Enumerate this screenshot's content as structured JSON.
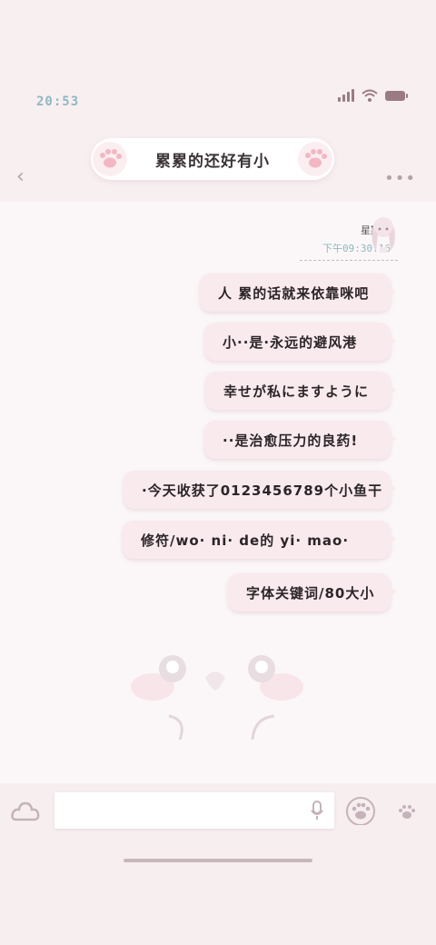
{
  "status_bar": {
    "time": "20:53",
    "icons": [
      "signal-icon",
      "wifi-icon",
      "battery-icon"
    ]
  },
  "header": {
    "title": "累累的还好有小",
    "back_icon": "chevron-left-icon",
    "more_icon": "more-icon",
    "more_label": "•••"
  },
  "thread": {
    "day_label": "星期五",
    "time_label": "下午09:30:16"
  },
  "messages": [
    {
      "text": "人 累的话就来依靠咪吧"
    },
    {
      "text": "小··是·永远的避风港"
    },
    {
      "text": "幸せが私にますように"
    },
    {
      "text": "··是治愈压力的良药!"
    },
    {
      "text": "·今天收获了0123456789个小鱼干"
    },
    {
      "text": "修符/wo· ni· de的 yi· mao·"
    },
    {
      "text": "字体关键词/80大小"
    }
  ],
  "input": {
    "placeholder": "",
    "mic_icon": "microphone-icon",
    "left_icon": "cloud-icon",
    "right_icons": [
      "paw-icon",
      "paw-small-icon"
    ]
  },
  "colors": {
    "accent": "#f9eaee",
    "time_teal": "#8fb8c2",
    "muted": "#b3a2a8"
  }
}
